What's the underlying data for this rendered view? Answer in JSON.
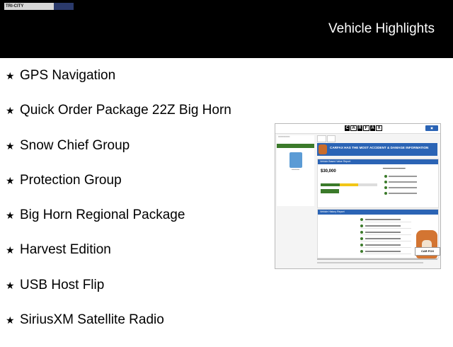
{
  "header": {
    "title": "Vehicle Highlights",
    "logo": {
      "brand": "TRI-CITY",
      "tagline": "",
      "phone": ""
    }
  },
  "features": [
    "GPS Navigation",
    "Quick Order Package 22Z Big Horn",
    "Snow Chief Group",
    "Protection Group",
    "Big Horn Regional Package",
    "Harvest Edition",
    "USB Host Flip",
    "SiriusXM Satellite Radio"
  ],
  "carfax": {
    "logo_letters": [
      "C",
      "A",
      "R",
      "F",
      "A",
      "X"
    ],
    "banner": "CARFAX HAS THE MOST ACCIDENT & DAMAGE INFORMATION",
    "value_header": "Vehicle Based Value Report",
    "price": "$30,000",
    "history_header": "Vehicle History Report",
    "fox_sign": "CAR FOX"
  },
  "colors": {
    "header_bg": "#000000",
    "carfax_blue": "#2b64b5",
    "carfax_green": "#3b7a2a"
  }
}
